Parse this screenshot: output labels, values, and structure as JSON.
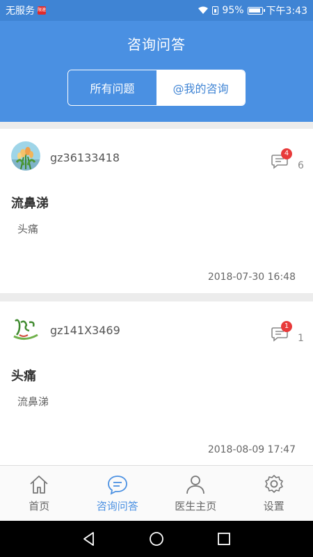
{
  "statusbar": {
    "carrier": "无服务",
    "battery": "95%",
    "time": "下午3:43"
  },
  "header": {
    "title": "咨询问答",
    "segments": [
      "所有问题",
      "@我的咨询"
    ]
  },
  "posts": [
    {
      "username": "gz36133418",
      "badge": "4",
      "count": "6",
      "title": "流鼻涕",
      "body": "头痛",
      "time": "2018-07-30 16:48"
    },
    {
      "username": "gz141X3469",
      "badge": "1",
      "count": "1",
      "title": "头痛",
      "body": "流鼻涕",
      "time": "2018-08-09 17:47"
    }
  ],
  "tabs": [
    "首页",
    "咨询问答",
    "医生主页",
    "设置"
  ],
  "colors": {
    "primary": "#4a90e2",
    "badge": "#e83a3a"
  }
}
